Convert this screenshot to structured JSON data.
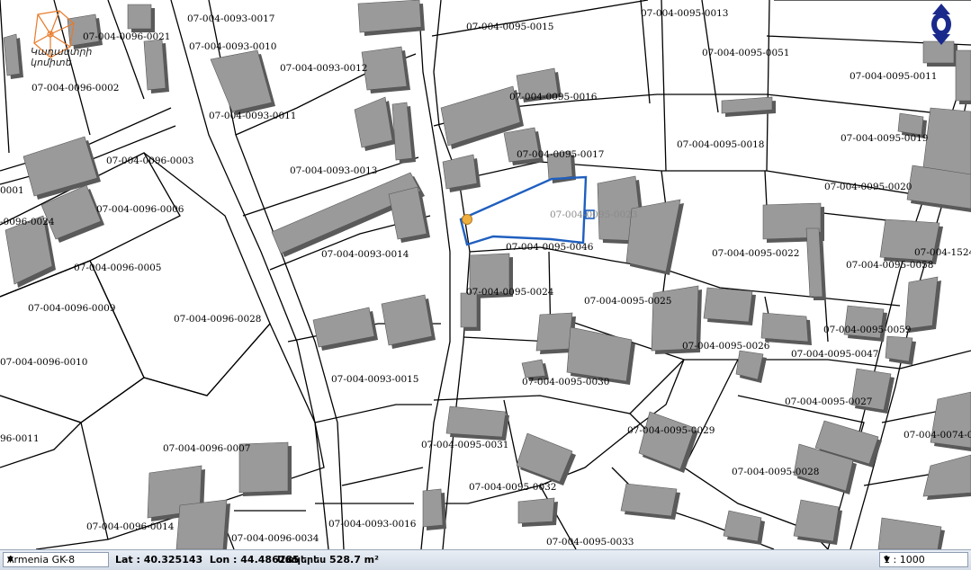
{
  "map": {
    "labels": {
      "p001": "07-004-0093-0017",
      "p002": "07-004-0093-0010",
      "p003": "07-004-0096-0021",
      "p004": "07-004-0096-0002",
      "p005": "07-004-0093-0012",
      "p006": "07-004-0093-0011",
      "p007": "07-004-0095-0015",
      "p008": "07-004-0095-0013",
      "p009": "07-004-0095-0051",
      "p010": "07-004-0095-0011",
      "p011": "07-004-0095-0016",
      "p012": "07-004-0095-0018",
      "p013": "07-004-0095-0019",
      "p014": "07-004-0095-0017",
      "p015": "07-004-0096-0003",
      "p016": "07-004-0093-0013",
      "p017": "07-004-0095-0020",
      "p018": "0001",
      "p019": "07-004-0096-0006",
      "p020": "-0096-0024",
      "p021": "07-004-0095-0023",
      "p022": "07-004-0095-0046",
      "p023": "07-004-0093-0014",
      "p024": "07-004-0095-0022",
      "p025": "07-004-1524",
      "p026": "07-004-0096-0005",
      "p027": "07-004-0095-0058",
      "p028": "07-004-0095-0024",
      "p029": "07-004-0095-0025",
      "p030": "07-004-0096-0009",
      "p031": "07-004-0096-0028",
      "p032": "07-004-0095-0059",
      "p033": "07-004-0095-0026",
      "p034": "07-004-0095-0047",
      "p035": "07-004-0096-0010",
      "p036": "07-004-0093-0015",
      "p037": "07-004-0095-0030",
      "p038": "07-004-0095-0027",
      "p039": "96-0011",
      "p040": "07-004-0095-0029",
      "p041": "07-004-0074-0",
      "p042": "07-004-0095-0031",
      "p043": "07-004-0096-0007",
      "p044": "07-004-0095-0028",
      "p045": "07-004-0095-0032",
      "p046": "07-004-0096-0014",
      "p047": "07-004-0093-0016",
      "p048": "07-004-0096-0034",
      "p049": "07-004-0095-0033"
    },
    "highlight_color": "#1f5fbf",
    "marker_color": "#f0b040",
    "compass_color": "#1a2a8c"
  },
  "logo": {
    "text": "Կադաստրի\nկոմիտե",
    "color": "#e87a2a"
  },
  "statusbar": {
    "projection": "Armenia GK-8",
    "coords": "Lat : 40.325143  Lon : 44.486285",
    "area": "Մակերես 528.7 m²",
    "scale": "1 : 1000"
  }
}
